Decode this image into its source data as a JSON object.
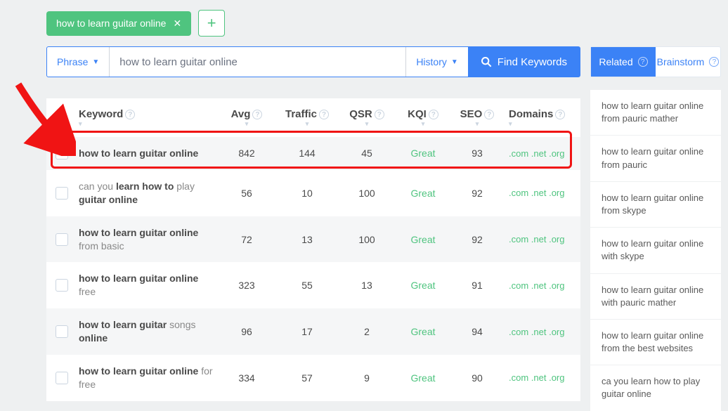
{
  "tag": {
    "label": "how to learn guitar online"
  },
  "search": {
    "phrase_label": "Phrase",
    "input_value": "how to learn guitar online",
    "history_label": "History",
    "find_label": "Find Keywords"
  },
  "headers": {
    "keyword": "Keyword",
    "avg": "Avg",
    "traffic": "Traffic",
    "qsr": "QSR",
    "kqi": "KQI",
    "seo": "SEO",
    "domains": "Domains"
  },
  "rows": [
    {
      "kw_bold": "how to learn guitar online",
      "kw_rest": "",
      "avg": "842",
      "traffic": "144",
      "qsr": "45",
      "kqi": "Great",
      "seo": "93",
      "domains": ".com .net .org"
    },
    {
      "kw_pre": "can you ",
      "kw_bold": "learn how to",
      "kw_rest": " play ",
      "kw_bold2": "guitar online",
      "avg": "56",
      "traffic": "10",
      "qsr": "100",
      "kqi": "Great",
      "seo": "92",
      "domains": ".com .net .org"
    },
    {
      "kw_bold": "how to learn guitar online",
      "kw_rest": " from basic",
      "avg": "72",
      "traffic": "13",
      "qsr": "100",
      "kqi": "Great",
      "seo": "92",
      "domains": ".com .net .org"
    },
    {
      "kw_bold": "how to learn guitar online",
      "kw_rest": " free",
      "avg": "323",
      "traffic": "55",
      "qsr": "13",
      "kqi": "Great",
      "seo": "91",
      "domains": ".com .net .org"
    },
    {
      "kw_bold": "how to learn guitar",
      "kw_rest": " songs ",
      "kw_bold2": "online",
      "avg": "96",
      "traffic": "17",
      "qsr": "2",
      "kqi": "Great",
      "seo": "94",
      "domains": ".com .net .org"
    },
    {
      "kw_bold": "how to learn guitar online",
      "kw_rest": " for free",
      "avg": "334",
      "traffic": "57",
      "qsr": "9",
      "kqi": "Great",
      "seo": "90",
      "domains": ".com .net .org"
    }
  ],
  "sidebar": {
    "tabs": {
      "related": "Related",
      "brainstorm": "Brainstorm"
    },
    "items": [
      "how to learn guitar online from pauric mather",
      "how to learn guitar online from pauric",
      "how to learn guitar online from skype",
      "how to learn guitar online with skype",
      "how to learn guitar online with pauric mather",
      "how to learn guitar online from the best websites",
      "ca you learn how to play guitar online"
    ]
  }
}
